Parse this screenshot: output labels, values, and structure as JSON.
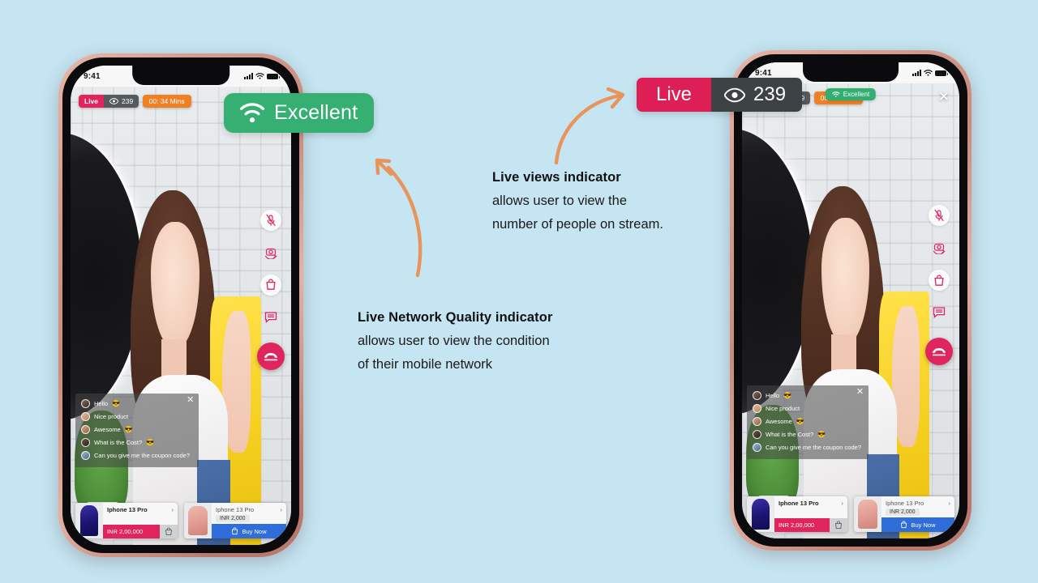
{
  "background_color": "#c6e5f2",
  "callouts": {
    "network": {
      "label": "Excellent",
      "icon": "wifi-icon",
      "color": "#35b072"
    },
    "live_views": {
      "live_label": "Live",
      "views_count": "239",
      "icon": "eye-icon",
      "live_color": "#dd1f55",
      "views_color": "#3d4244"
    }
  },
  "annotations": [
    {
      "title": "Live views  indicator",
      "lines": [
        "allows user to view the",
        "number of people on stream."
      ]
    },
    {
      "title": "Live Network Quality  indicator",
      "lines": [
        " allows user to view the condition",
        "of their mobile network"
      ]
    }
  ],
  "arrow_color": "#e8945a",
  "phone": {
    "status_bar": {
      "time": "9:41",
      "icons": [
        "signal-bars-icon",
        "wifi-icon",
        "battery-icon"
      ]
    },
    "badges": {
      "live_label": "Live",
      "views_count": "239",
      "views_icon": "eye-icon",
      "timer": "00: 34 Mins",
      "live_color": "#e0245e",
      "views_color": "#555a5c",
      "timer_color": "#ef8023"
    },
    "network_mini": {
      "label": "Excellent",
      "icon": "wifi-icon"
    },
    "close_icon": "close-icon",
    "action_rail": [
      {
        "name": "microphone-muted-icon"
      },
      {
        "name": "camera-flip-icon"
      },
      {
        "name": "shopping-bag-icon"
      },
      {
        "name": "chat-bubble-icon"
      },
      {
        "name": "end-call-icon"
      }
    ],
    "chat": {
      "close_icon": "close-icon",
      "messages": [
        {
          "text": "Hello",
          "emoji": "😎"
        },
        {
          "text": "Nice product",
          "emoji": ""
        },
        {
          "text": "Awesome",
          "emoji": "😎"
        },
        {
          "text": "What is the Cost?",
          "emoji": "😎"
        },
        {
          "text": "Can you give me the coupon code?",
          "emoji": ""
        }
      ]
    },
    "products": [
      {
        "title": "Iphone 13 Pro",
        "price": "INR 2,00,000",
        "chevron": "›",
        "cta_type": "price",
        "bag_icon": "shopping-bag-icon",
        "accent": "#e0245e"
      },
      {
        "title": "Iphone 13 Pro",
        "price": "INR 2,000",
        "chevron": "›",
        "cta_type": "buy",
        "cta_label": "Buy Now",
        "bag_icon": "shopping-bag-icon",
        "accent": "#2f6ddb"
      }
    ]
  }
}
